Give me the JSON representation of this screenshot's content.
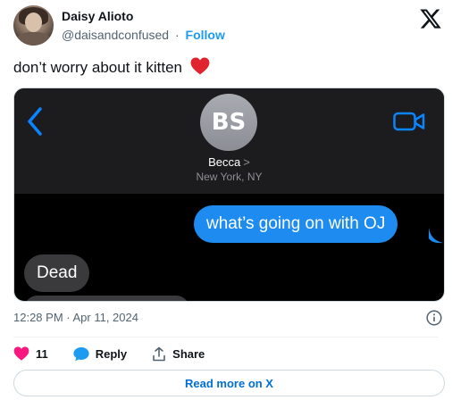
{
  "tweet": {
    "author_name": "Daisy Alioto",
    "handle": "@daisandconfused",
    "separator": "·",
    "follow_label": "Follow",
    "text": "don’t worry about it kitten",
    "text_emoji": "red-heart-emoji",
    "timestamp": "12:28 PM · Apr 11, 2024"
  },
  "media": {
    "contact_initials": "BS",
    "contact_name": "Becca",
    "contact_chevron": ">",
    "contact_location": "New York, NY",
    "outgoing_message": "what’s going on with OJ",
    "incoming_message": "Dead",
    "colors": {
      "header_bg": "#1c1c1e",
      "outgoing_bubble": "#1d8bf0",
      "incoming_bubble": "#3a3a3c",
      "ios_blue": "#0a84ff"
    }
  },
  "actions": {
    "like_count": "11",
    "reply_label": "Reply",
    "share_label": "Share"
  },
  "footer": {
    "read_more_label": "Read more on X"
  },
  "colors": {
    "accent": "#1d9bf0",
    "like": "#f91880",
    "secondary_text": "#536471"
  }
}
